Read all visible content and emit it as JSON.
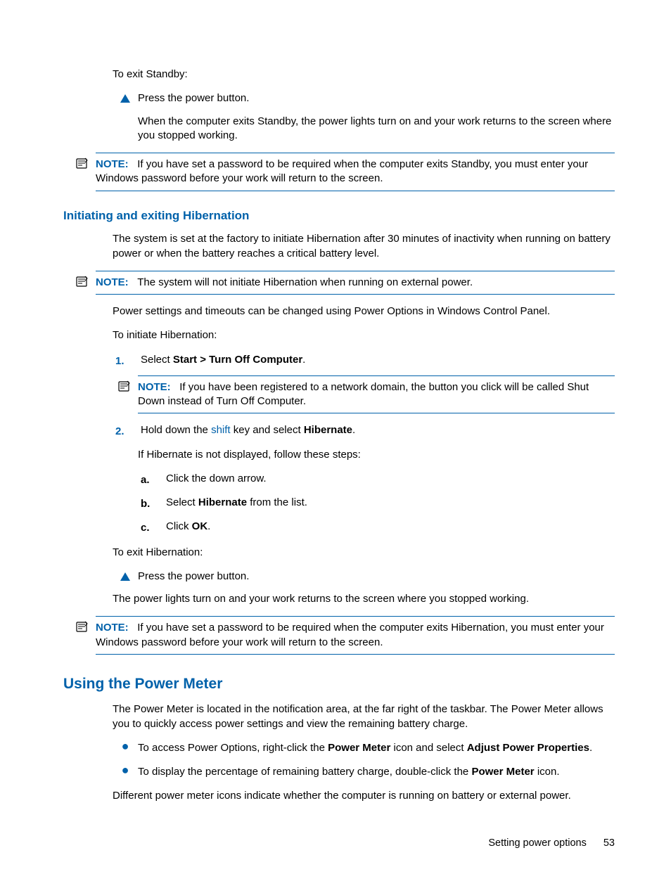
{
  "intro": {
    "exitStandby": "To exit Standby:",
    "pressPower": "Press the power button.",
    "exitStandbyDetail": "When the computer exits Standby, the power lights turn on and your work returns to the screen where you stopped working."
  },
  "note1": {
    "label": "NOTE:",
    "text": "If you have set a password to be required when the computer exits Standby, you must enter your Windows password before your work will return to the screen."
  },
  "hib": {
    "heading": "Initiating and exiting Hibernation",
    "para1": "The system is set at the factory to initiate Hibernation after 30 minutes of inactivity when running on battery power or when the battery reaches a critical battery level.",
    "note": {
      "label": "NOTE:",
      "text": "The system will not initiate Hibernation when running on external power."
    },
    "para2": "Power settings and timeouts can be changed using Power Options in Windows Control Panel.",
    "para3": "To initiate Hibernation:",
    "step1num": "1.",
    "step1a": "Select ",
    "step1b": "Start > Turn Off Computer",
    "step1c": ".",
    "step1note": {
      "label": "NOTE:",
      "text": "If you have been registered to a network domain, the button you click will be called Shut Down instead of Turn Off Computer."
    },
    "step2num": "2.",
    "step2a": "Hold down the ",
    "step2link": "shift",
    "step2b": " key and select ",
    "step2bold": "Hibernate",
    "step2c": ".",
    "step2note": "If Hibernate is not displayed, follow these steps:",
    "sub": {
      "a_marker": "a.",
      "a_text": "Click the down arrow.",
      "b_marker": "b.",
      "b_pre": "Select ",
      "b_bold": "Hibernate",
      "b_post": " from the list.",
      "c_marker": "c.",
      "c_pre": "Click ",
      "c_bold": "OK",
      "c_post": "."
    },
    "exit": "To exit Hibernation:",
    "exitStep": "Press the power button.",
    "exitDetail": "The power lights turn on and your work returns to the screen where you stopped working.",
    "exitNote": {
      "label": "NOTE:",
      "text": "If you have set a password to be required when the computer exits Hibernation, you must enter your Windows password before your work will return to the screen."
    }
  },
  "pm": {
    "heading": "Using the Power Meter",
    "para1": "The Power Meter is located in the notification area, at the far right of the taskbar. The Power Meter allows you to quickly access power settings and view the remaining battery charge.",
    "b1a": "To access Power Options, right-click the ",
    "b1bold1": "Power Meter",
    "b1b": " icon and select ",
    "b1bold2": "Adjust Power Properties",
    "b1c": ".",
    "b2a": "To display the percentage of remaining battery charge, double-click the ",
    "b2bold": "Power Meter",
    "b2b": " icon.",
    "para2": "Different power meter icons indicate whether the computer is running on battery or external power."
  },
  "footer": {
    "section": "Setting power options",
    "page": "53"
  }
}
